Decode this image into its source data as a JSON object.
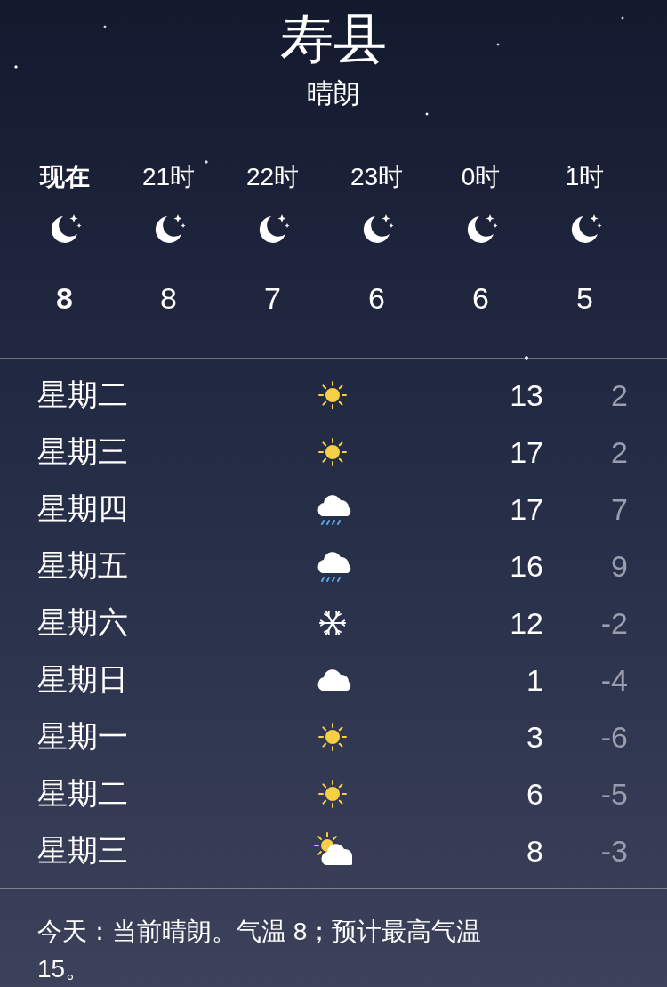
{
  "location": {
    "city": "寿县",
    "condition": "晴朗"
  },
  "hourly": [
    {
      "time": "现在",
      "kind": "clear-night",
      "temp": "8",
      "current": true
    },
    {
      "time": "21时",
      "kind": "clear-night",
      "temp": "8",
      "current": false
    },
    {
      "time": "22时",
      "kind": "clear-night",
      "temp": "7",
      "current": false
    },
    {
      "time": "23时",
      "kind": "clear-night",
      "temp": "6",
      "current": false
    },
    {
      "time": "0时",
      "kind": "clear-night",
      "temp": "6",
      "current": false
    },
    {
      "time": "1时",
      "kind": "clear-night",
      "temp": "5",
      "current": false
    }
  ],
  "daily": [
    {
      "day": "星期二",
      "kind": "sunny",
      "high": "13",
      "low": "2"
    },
    {
      "day": "星期三",
      "kind": "sunny",
      "high": "17",
      "low": "2"
    },
    {
      "day": "星期四",
      "kind": "rain",
      "high": "17",
      "low": "7"
    },
    {
      "day": "星期五",
      "kind": "rain",
      "high": "16",
      "low": "9"
    },
    {
      "day": "星期六",
      "kind": "snow",
      "high": "12",
      "low": "-2"
    },
    {
      "day": "星期日",
      "kind": "cloudy",
      "high": "1",
      "low": "-4"
    },
    {
      "day": "星期一",
      "kind": "sunny",
      "high": "3",
      "low": "-6"
    },
    {
      "day": "星期二",
      "kind": "sunny",
      "high": "6",
      "low": "-5"
    },
    {
      "day": "星期三",
      "kind": "partly-cloudy",
      "high": "8",
      "low": "-3"
    }
  ],
  "summary": "今天：当前晴朗。气温 8；预计最高气温 15。"
}
